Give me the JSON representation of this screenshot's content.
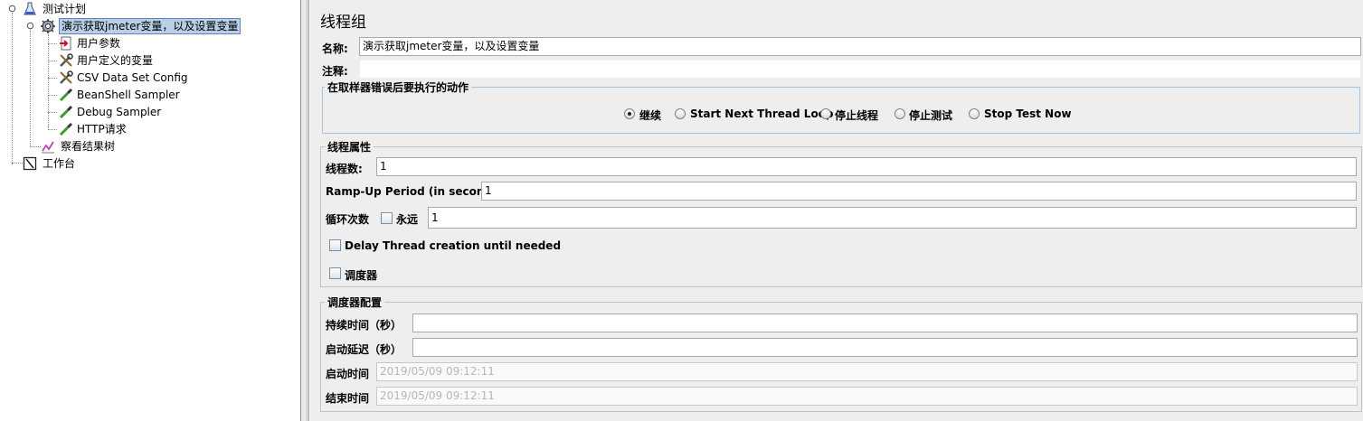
{
  "tree": {
    "test_plan": "测试计划",
    "thread_group": "演示获取jmeter变量，以及设置变量",
    "user_params": "用户参数",
    "user_vars": "用户定义的变量",
    "csv_config": "CSV Data Set Config",
    "beanshell": "BeanShell Sampler",
    "debug": "Debug Sampler",
    "http": "HTTP请求",
    "results_tree": "察看结果树",
    "workbench": "工作台"
  },
  "form": {
    "title": "线程组",
    "name_label": "名称:",
    "name_value": "演示获取jmeter变量，以及设置变量",
    "comment_label": "注释:",
    "comment_value": "",
    "error_group": {
      "title": "在取样器错误后要执行的动作",
      "options": [
        "继续",
        "Start Next Thread Loop",
        "停止线程",
        "停止测试",
        "Stop Test Now"
      ],
      "selected": "继续"
    },
    "thread_props": {
      "title": "线程属性",
      "threads_label": "线程数:",
      "threads_value": "1",
      "rampup_label": "Ramp-Up Period (in seconds):",
      "rampup_value": "1",
      "loop_label": "循环次数",
      "forever_label": "永远",
      "forever_checked": false,
      "loop_value": "1",
      "delay_label": "Delay Thread creation until needed",
      "delay_checked": false,
      "scheduler_label": "调度器",
      "scheduler_checked": false
    },
    "scheduler_config": {
      "title": "调度器配置",
      "duration_label": "持续时间（秒）",
      "duration_value": "",
      "startup_delay_label": "启动延迟（秒）",
      "startup_delay_value": "",
      "start_time_label": "启动时间",
      "start_time_value": "2019/05/09 09:12:11",
      "end_time_label": "结束时间",
      "end_time_value": "2019/05/09 09:12:11"
    }
  },
  "colors": {
    "selection": "#b8cfe5",
    "panel_bg": "#eeeeee",
    "disabled_text": "#b6b6b6"
  },
  "icons": [
    "flask-icon",
    "gear-icon",
    "user-params-icon",
    "wrench-icon",
    "pipette-icon",
    "graph-icon",
    "workbench-icon"
  ]
}
